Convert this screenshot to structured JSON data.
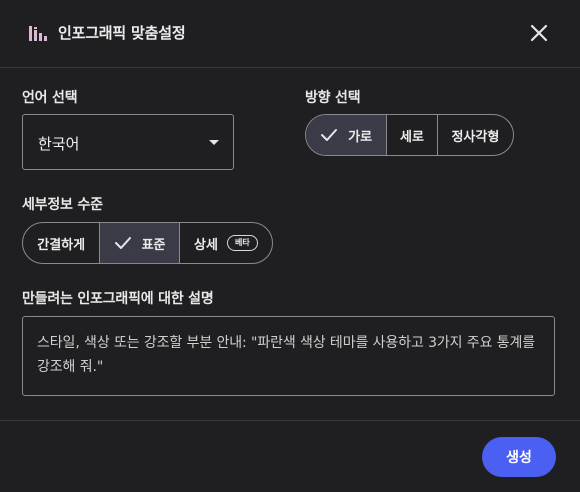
{
  "header": {
    "title": "인포그래픽 맞춤설정",
    "icon": "infographic-chart-icon",
    "close_icon": "close-icon"
  },
  "language": {
    "label": "언어 선택",
    "selected": "한국어",
    "caret_icon": "caret-down-icon"
  },
  "orientation": {
    "label": "방향 선택",
    "options": [
      {
        "label": "가로",
        "selected": true
      },
      {
        "label": "세로",
        "selected": false
      },
      {
        "label": "정사각형",
        "selected": false
      }
    ]
  },
  "detail": {
    "label": "세부정보 수준",
    "options": [
      {
        "label": "간결하게",
        "selected": false
      },
      {
        "label": "표준",
        "selected": true
      },
      {
        "label": "상세",
        "selected": false,
        "badge": "베타"
      }
    ]
  },
  "prompt": {
    "label": "만들려는 인포그래픽에 대한 설명",
    "placeholder": "스타일, 색상 또는 강조할 부분 안내: \"파란색 색상 테마를 사용하고 3가지 주요 통계를 강조해 줘.\""
  },
  "footer": {
    "submit_label": "생성"
  },
  "colors": {
    "background": "#1f1f21",
    "selected_segment": "#3a3b46",
    "primary_button": "#4b60f2",
    "border": "#8a8a8e"
  }
}
